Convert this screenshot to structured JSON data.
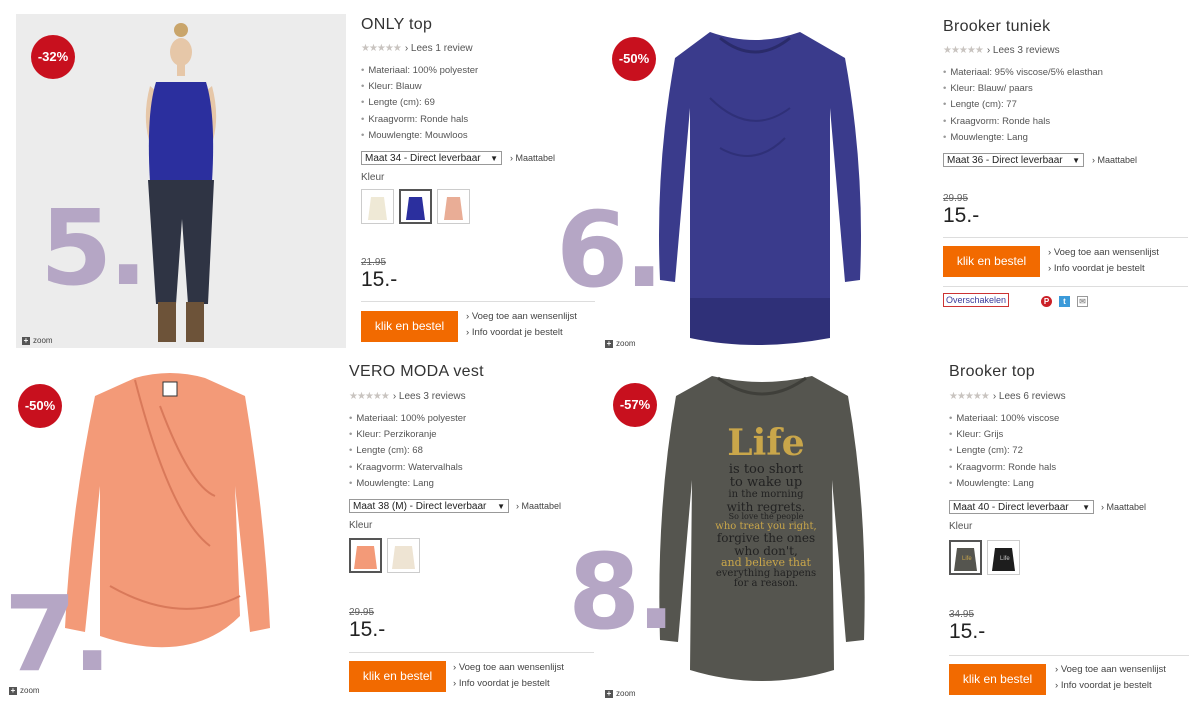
{
  "products": [
    {
      "id": "5",
      "number": "5.",
      "discount": "-32%",
      "title": "ONLY top",
      "stars": "★★★★★",
      "review": "› Lees 1 review",
      "specs": [
        "Materiaal: 100% polyester",
        "Kleur: Blauw",
        "Lengte (cm): 69",
        "Kraagvorm: Ronde hals",
        "Mouwlengte: Mouwloos"
      ],
      "size_select": "Maat 34 - Direct leverbaar",
      "maattabel": "› Maattabel",
      "kleur": "Kleur",
      "old_price": "21.95",
      "price": "15.-",
      "button": "klik en bestel",
      "links": [
        "Voeg toe aan wensenlijst",
        "Info voordat je bestelt"
      ],
      "zoom": "zoom",
      "colors": {
        "garment": "#2b2f9e",
        "swatches": [
          "#efe9d6",
          "#2b2f9e",
          "#e9ad96"
        ]
      }
    },
    {
      "id": "6",
      "number": "6.",
      "discount": "-50%",
      "title": "Brooker tuniek",
      "stars": "★★★★★",
      "review": "› Lees 3 reviews",
      "specs": [
        "Materiaal: 95% viscose/5% elasthan",
        "Kleur: Blauw/ paars",
        "Lengte (cm): 77",
        "Kraagvorm: Ronde hals",
        "Mouwlengte: Lang"
      ],
      "size_select": "Maat 36 - Direct leverbaar",
      "maattabel": "› Maattabel",
      "old_price": "29.95",
      "price": "15.-",
      "button": "klik en bestel",
      "links": [
        "Voeg toe aan wensenlijst",
        "Info voordat je bestelt"
      ],
      "overschakelen": "Overschakelen",
      "zoom": "zoom",
      "colors": {
        "garment": "#3a3b8c"
      }
    },
    {
      "id": "7",
      "number": "7.",
      "discount": "-50%",
      "title": "VERO MODA vest",
      "stars": "★★★★★",
      "review": "› Lees 3 reviews",
      "specs": [
        "Materiaal: 100% polyester",
        "Kleur: Perzikoranje",
        "Lengte (cm): 68",
        "Kraagvorm: Watervalhals",
        "Mouwlengte: Lang"
      ],
      "size_select": "Maat 38 (M) - Direct leverbaar",
      "maattabel": "› Maattabel",
      "kleur": "Kleur",
      "old_price": "29.95",
      "price": "15.-",
      "button": "klik en bestel",
      "links": [
        "Voeg toe aan wensenlijst",
        "Info voordat je bestelt"
      ],
      "zoom": "zoom",
      "colors": {
        "garment": "#f39a78",
        "swatches": [
          "#f39a78",
          "#eee4d3"
        ]
      }
    },
    {
      "id": "8",
      "number": "8.",
      "discount": "-57%",
      "title": "Brooker top",
      "stars": "★★★★★",
      "review": "› Lees 6 reviews",
      "specs": [
        "Materiaal: 100% viscose",
        "Kleur: Grijs",
        "Lengte (cm): 72",
        "Kraagvorm: Ronde hals",
        "Mouwlengte: Lang"
      ],
      "size_select": "Maat 40 - Direct leverbaar",
      "maattabel": "› Maattabel",
      "kleur": "Kleur",
      "old_price": "34.95",
      "price": "15.-",
      "button": "klik en bestel",
      "links": [
        "Voeg toe aan wensenlijst",
        "Info voordat je bestelt"
      ],
      "zoom": "zoom",
      "print_text": [
        "Life",
        "is too short",
        "to wake up",
        "in the morning",
        "with regrets.",
        "So love the people",
        "who treat you right,",
        "forgive the ones",
        "who don't,",
        "and believe that",
        "everything happens",
        "for a reason."
      ],
      "colors": {
        "garment": "#55554f",
        "print": "#c9a64a",
        "swatches": [
          "#55554f",
          "#1d1d1d"
        ]
      }
    }
  ]
}
